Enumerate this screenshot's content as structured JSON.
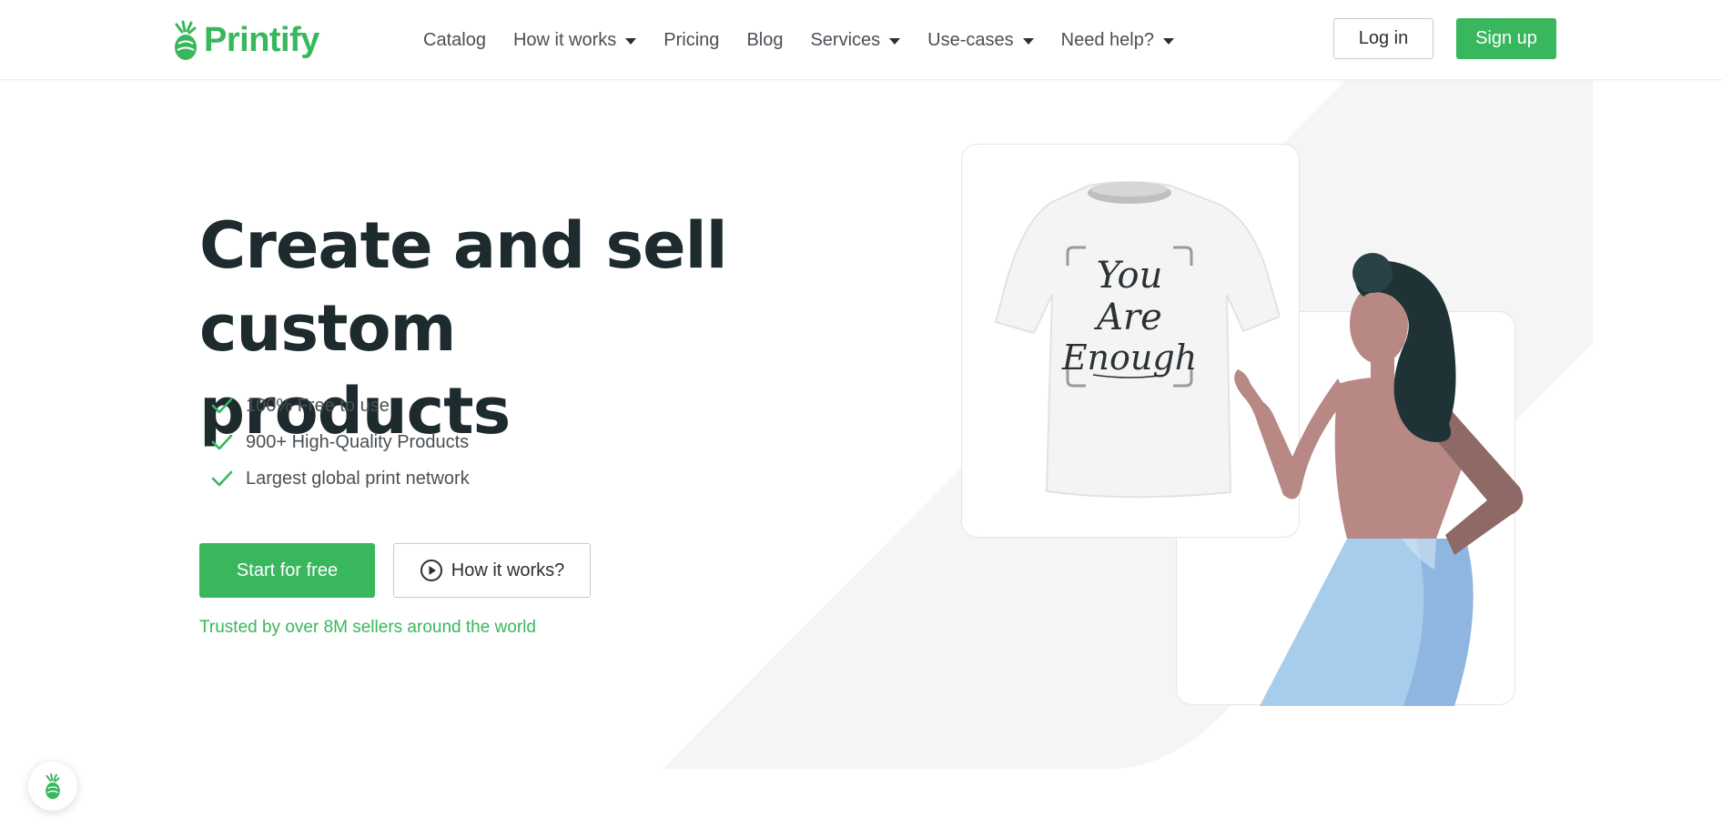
{
  "brand": {
    "name": "Printify",
    "color": "#39b75d",
    "logo_icon": "pineapple-icon"
  },
  "nav": {
    "items": [
      {
        "label": "Catalog",
        "dropdown": false
      },
      {
        "label": "How it works",
        "dropdown": true
      },
      {
        "label": "Pricing",
        "dropdown": false
      },
      {
        "label": "Blog",
        "dropdown": false
      },
      {
        "label": "Services",
        "dropdown": true
      },
      {
        "label": "Use-cases",
        "dropdown": true
      },
      {
        "label": "Need help?",
        "dropdown": true
      }
    ],
    "login_label": "Log in",
    "signup_label": "Sign up"
  },
  "hero": {
    "title_line1": "Create and sell",
    "title_line2": "custom products",
    "features": [
      "100% Free to use",
      "900+ High-Quality Products",
      "Largest global print network"
    ],
    "primary_cta": "Start for free",
    "secondary_cta": "How it works?",
    "secondary_cta_icon": "play-circle-icon",
    "trusted_text": "Trusted by over 8M sellers around the world"
  },
  "illustration": {
    "tshirt_print_lines": [
      "You",
      "Are",
      "Enough"
    ],
    "shirt_color": "#f4f4f4",
    "skin_color": "#b88884",
    "hair_color": "#1f3337",
    "skirt_color": "#9cc5e8"
  },
  "chat": {
    "icon": "pineapple-icon"
  }
}
